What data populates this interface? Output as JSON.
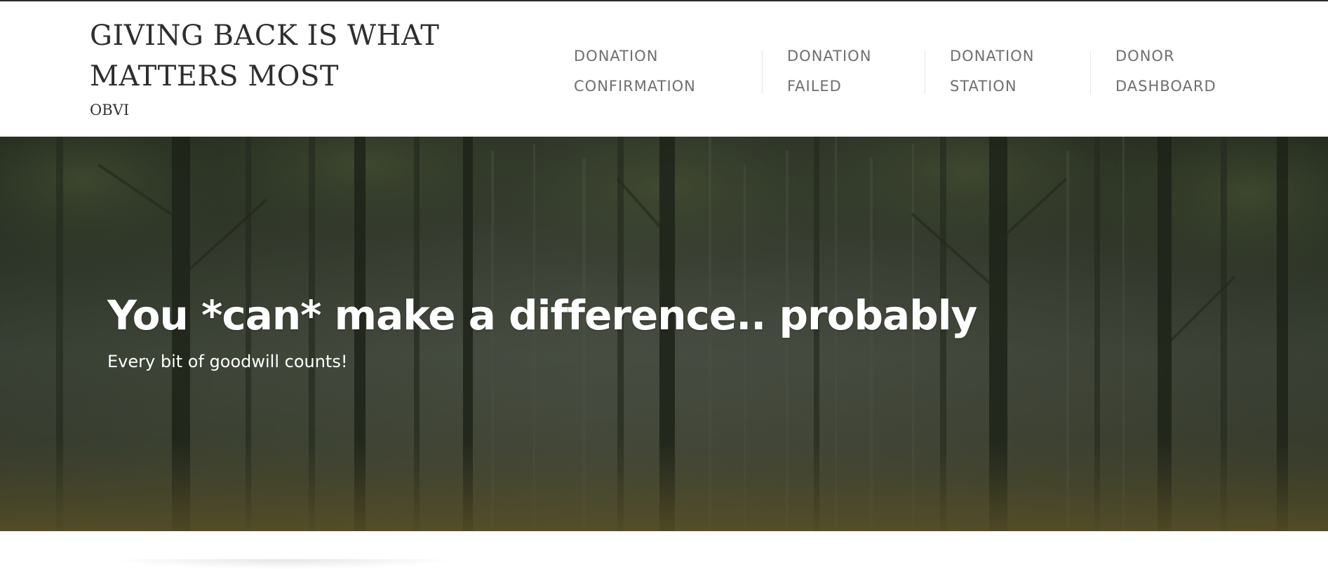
{
  "site": {
    "title_line1": "GIVING BACK IS WHAT",
    "title_line2": "MATTERS MOST",
    "tagline": "OBVI"
  },
  "nav": {
    "items": [
      {
        "line1": "DONATION",
        "line2": "CONFIRMATION"
      },
      {
        "line1": "DONATION",
        "line2": "FAILED"
      },
      {
        "line1": "DONATION",
        "line2": "STATION"
      },
      {
        "line1": "DONOR",
        "line2": "DASHBOARD"
      }
    ]
  },
  "hero": {
    "title": "You *can* make a difference.. probably",
    "subtitle": "Every bit of goodwill counts!",
    "image_icon": "forest-background-image"
  },
  "colors": {
    "nav_text": "#6f6f6f",
    "title_text": "#2e2e2e",
    "hero_text": "#ffffff"
  }
}
